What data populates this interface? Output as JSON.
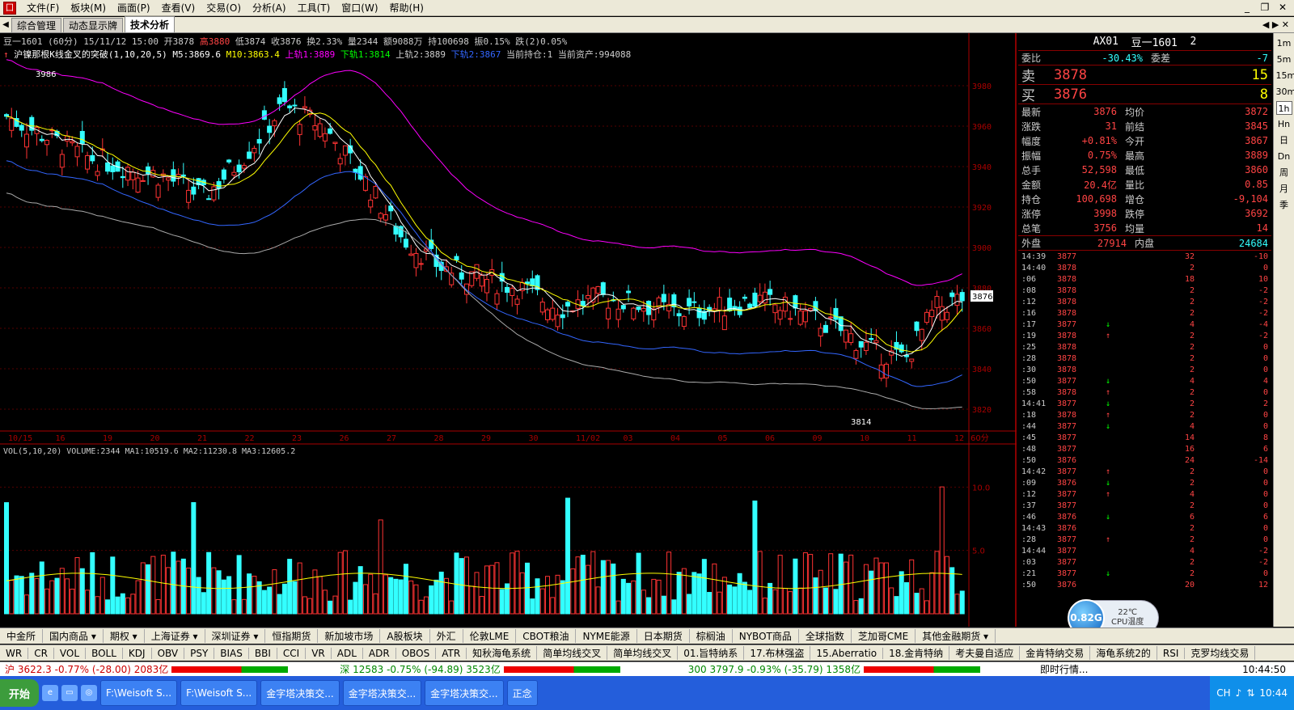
{
  "menu": [
    "文件(F)",
    "板块(M)",
    "画面(P)",
    "查看(V)",
    "交易(O)",
    "分析(A)",
    "工具(T)",
    "窗口(W)",
    "帮助(H)"
  ],
  "tabs": [
    "综合管理",
    "动态显示牌",
    "技术分析"
  ],
  "chart_header": {
    "symbol": "豆一1601",
    "period": "(60分)",
    "date": "15/11/12 15:00",
    "open": "开3878",
    "high": "高3880",
    "low": "低3874",
    "close": "收3876",
    "turnover": "换2.33%",
    "volume": "量2344",
    "amount": "额9088万",
    "hold": "持100698",
    "amplitude": "振0.15%",
    "change": "跌(2)0.05%"
  },
  "indicator_line": {
    "name": "沪镍那根K线金叉的突破(1,10,20,5)",
    "m5": "M5:3869.6",
    "m10": "M10:3863.4",
    "up1": "上轨1:3889",
    "down1": "下轨1:3814",
    "up2": "上轨2:3889",
    "down2": "下轨2:3867",
    "pos": "当前持仓:1",
    "asset": "当前资产:994088"
  },
  "vol_header": {
    "name": "VOL(5,10,20)",
    "volume": "VOLUME:2344",
    "ma1": "MA1:10519.6",
    "ma2": "MA2:11230.8",
    "ma3": "MA3:12605.2"
  },
  "price_axis": [
    "3980",
    "3960",
    "3940",
    "3920",
    "3900",
    "3880",
    "3860",
    "3840",
    "3820"
  ],
  "vol_axis": [
    "10.0",
    "5.0"
  ],
  "date_axis": [
    "10/15",
    "16",
    "19",
    "20",
    "21",
    "22",
    "23",
    "26",
    "27",
    "28",
    "29",
    "30",
    "11/02",
    "03",
    "04",
    "05",
    "06",
    "09",
    "10",
    "11",
    "12"
  ],
  "period_label": "60分",
  "price_tag": "3876",
  "labels": {
    "high_mark": "3986",
    "low_mark": "3814"
  },
  "chart_data": {
    "type": "candlestick",
    "title": "豆一1601 (60分)",
    "ylim": [
      3810,
      3990
    ],
    "last_close": 3876,
    "period": "60分"
  },
  "quote": {
    "header_code": "AX01",
    "header_name": "豆一1601",
    "header_num": "2",
    "webi_label": "委比",
    "webi": "-30.43%",
    "weicha_label": "委差",
    "weicha": "-7",
    "sell_label": "卖",
    "sell_price": "3878",
    "sell_vol": "15",
    "buy_label": "买",
    "buy_price": "3876",
    "buy_vol": "8",
    "rows": [
      {
        "l1": "最新",
        "v1": "3876",
        "l2": "均价",
        "v2": "3872"
      },
      {
        "l1": "涨跌",
        "v1": "31",
        "l2": "前结",
        "v2": "3845"
      },
      {
        "l1": "幅度",
        "v1": "+0.81%",
        "l2": "今开",
        "v2": "3867"
      },
      {
        "l1": "振幅",
        "v1": "0.75%",
        "l2": "最高",
        "v2": "3889"
      },
      {
        "l1": "总手",
        "v1": "52,598",
        "l2": "最低",
        "v2": "3860"
      },
      {
        "l1": "金额",
        "v1": "20.4亿",
        "l2": "量比",
        "v2": "0.85"
      },
      {
        "l1": "持仓",
        "v1": "100,698",
        "l2": "增仓",
        "v2": "-9,104"
      },
      {
        "l1": "涨停",
        "v1": "3998",
        "l2": "跌停",
        "v2": "3692"
      },
      {
        "l1": "总笔",
        "v1": "3756",
        "l2": "均量",
        "v2": "14"
      }
    ],
    "outer_label": "外盘",
    "outer": "27914",
    "inner_label": "内盘",
    "inner": "24684"
  },
  "ticks": [
    {
      "t": "14:39",
      "p": "3877",
      "d": "",
      "v": "32",
      "c": "-10"
    },
    {
      "t": "14:40",
      "p": "3878",
      "d": "",
      "v": "2",
      "c": "0"
    },
    {
      "t": ":06",
      "p": "3878",
      "d": "",
      "v": "18",
      "c": "10"
    },
    {
      "t": ":08",
      "p": "3878",
      "d": "",
      "v": "2",
      "c": "-2"
    },
    {
      "t": ":12",
      "p": "3878",
      "d": "",
      "v": "2",
      "c": "-2"
    },
    {
      "t": ":16",
      "p": "3878",
      "d": "",
      "v": "2",
      "c": "-2"
    },
    {
      "t": ":17",
      "p": "3877",
      "d": "↓",
      "v": "4",
      "c": "-4"
    },
    {
      "t": ":19",
      "p": "3878",
      "d": "↑",
      "v": "2",
      "c": "-2"
    },
    {
      "t": ":25",
      "p": "3878",
      "d": "",
      "v": "2",
      "c": "0"
    },
    {
      "t": ":28",
      "p": "3878",
      "d": "",
      "v": "2",
      "c": "0"
    },
    {
      "t": ":30",
      "p": "3878",
      "d": "",
      "v": "2",
      "c": "0"
    },
    {
      "t": ":50",
      "p": "3877",
      "d": "↓",
      "v": "4",
      "c": "4"
    },
    {
      "t": ":58",
      "p": "3878",
      "d": "↑",
      "v": "2",
      "c": "0"
    },
    {
      "t": "14:41",
      "p": "3877",
      "d": "↓",
      "v": "2",
      "c": "2"
    },
    {
      "t": ":18",
      "p": "3878",
      "d": "↑",
      "v": "2",
      "c": "0"
    },
    {
      "t": ":44",
      "p": "3877",
      "d": "↓",
      "v": "4",
      "c": "0"
    },
    {
      "t": ":45",
      "p": "3877",
      "d": "",
      "v": "14",
      "c": "8"
    },
    {
      "t": ":48",
      "p": "3877",
      "d": "",
      "v": "16",
      "c": "6"
    },
    {
      "t": ":50",
      "p": "3876",
      "d": "",
      "v": "24",
      "c": "-14"
    },
    {
      "t": "14:42",
      "p": "3877",
      "d": "↑",
      "v": "2",
      "c": "0"
    },
    {
      "t": ":09",
      "p": "3876",
      "d": "↓",
      "v": "2",
      "c": "0"
    },
    {
      "t": ":12",
      "p": "3877",
      "d": "↑",
      "v": "4",
      "c": "0"
    },
    {
      "t": ":37",
      "p": "3877",
      "d": "",
      "v": "2",
      "c": "0"
    },
    {
      "t": ":46",
      "p": "3876",
      "d": "↓",
      "v": "6",
      "c": "6"
    },
    {
      "t": "14:43",
      "p": "3876",
      "d": "",
      "v": "2",
      "c": "0"
    },
    {
      "t": ":28",
      "p": "3877",
      "d": "↑",
      "v": "2",
      "c": "0"
    },
    {
      "t": "14:44",
      "p": "3877",
      "d": "",
      "v": "4",
      "c": "-2"
    },
    {
      "t": ":03",
      "p": "3877",
      "d": "",
      "v": "2",
      "c": "-2"
    },
    {
      "t": ":21",
      "p": "3877",
      "d": "↓",
      "v": "2",
      "c": "0"
    },
    {
      "t": ":50",
      "p": "3876",
      "d": "",
      "v": "20",
      "c": "12"
    }
  ],
  "side_tools": [
    "1m",
    "5m",
    "15m",
    "30m",
    "1h",
    "Hn",
    "日",
    "Dn",
    "周",
    "月",
    "季"
  ],
  "categories": [
    "中金所",
    "国内商品 ▾",
    "期权 ▾",
    "上海证券 ▾",
    "深圳证券 ▾",
    "恒指期货",
    "新加坡市场",
    "A股板块",
    "外汇",
    "伦敦LME",
    "CBOT粮油",
    "NYME能源",
    "日本期货",
    "棕榈油",
    "NYBOT商品",
    "全球指数",
    "芝加哥CME",
    "其他金融期货 ▾"
  ],
  "indicators": [
    "WR",
    "CR",
    "VOL",
    "BOLL",
    "KDJ",
    "OBV",
    "PSY",
    "BIAS",
    "BBI",
    "CCI",
    "VR",
    "ADL",
    "ADR",
    "OBOS",
    "ATR",
    "知秋海龟系统",
    "简单均线交叉",
    "简单均线交叉",
    "01.旨特纳系",
    "17.布林强盗",
    "15.Aberratio",
    "18.金肯特纳",
    "考夫曼自适应",
    "金肯特纳交易",
    "海龟系统2的",
    "RSI",
    "克罗均线交易"
  ],
  "status": {
    "sh": "沪 3622.3 -0.77% (-28.00) 2083亿",
    "sz": "深 12583 -0.75% (-94.89) 3523亿",
    "hs300": "300 3797.9 -0.93% (-35.79) 1358亿",
    "news": "即时行情...",
    "time": "10:44:50"
  },
  "taskbar": {
    "start": "开始",
    "items": [
      "F:\\Weisoft S...",
      "F:\\Weisoft S...",
      "金字塔决策交...",
      "金字塔决策交...",
      "金字塔决策交...",
      "正念"
    ],
    "clock": "10:44",
    "ime": "CH"
  },
  "cpu": {
    "value": "0.82G",
    "temp": "22℃",
    "label": "CPU温度"
  },
  "colors": {
    "up": "#ff3333",
    "down": "#33ffff",
    "bg": "#000000",
    "grid": "#800000"
  }
}
